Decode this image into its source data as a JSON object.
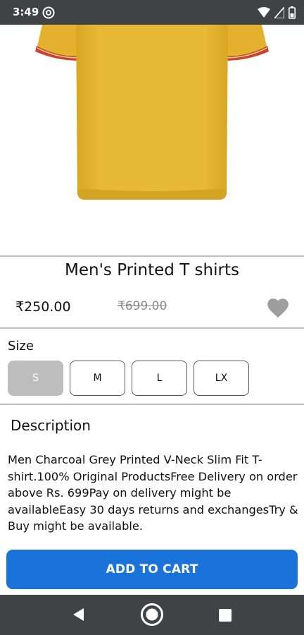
{
  "status_bar": {
    "time": "3:49"
  },
  "product": {
    "title": "Men's Printed T shirts",
    "price": "₹250.00",
    "mrp": "₹699.00"
  },
  "size": {
    "label": "Size",
    "options": [
      "S",
      "M",
      "L",
      "LX"
    ],
    "selected": "S"
  },
  "description": {
    "title": "Description",
    "text": "Men Charcoal Grey Printed V-Neck Slim Fit T-shirt.100% Original ProductsFree Delivery on order above Rs. 699Pay on delivery might be availableEasy 30 days returns and exchangesTry & Buy might be available."
  },
  "cart": {
    "label": "ADD TO CART"
  },
  "colors": {
    "accent": "#1a73d9",
    "shirt": "#e8b935",
    "selected_size": "#bdbdbd",
    "system_bar": "#3f4346"
  }
}
